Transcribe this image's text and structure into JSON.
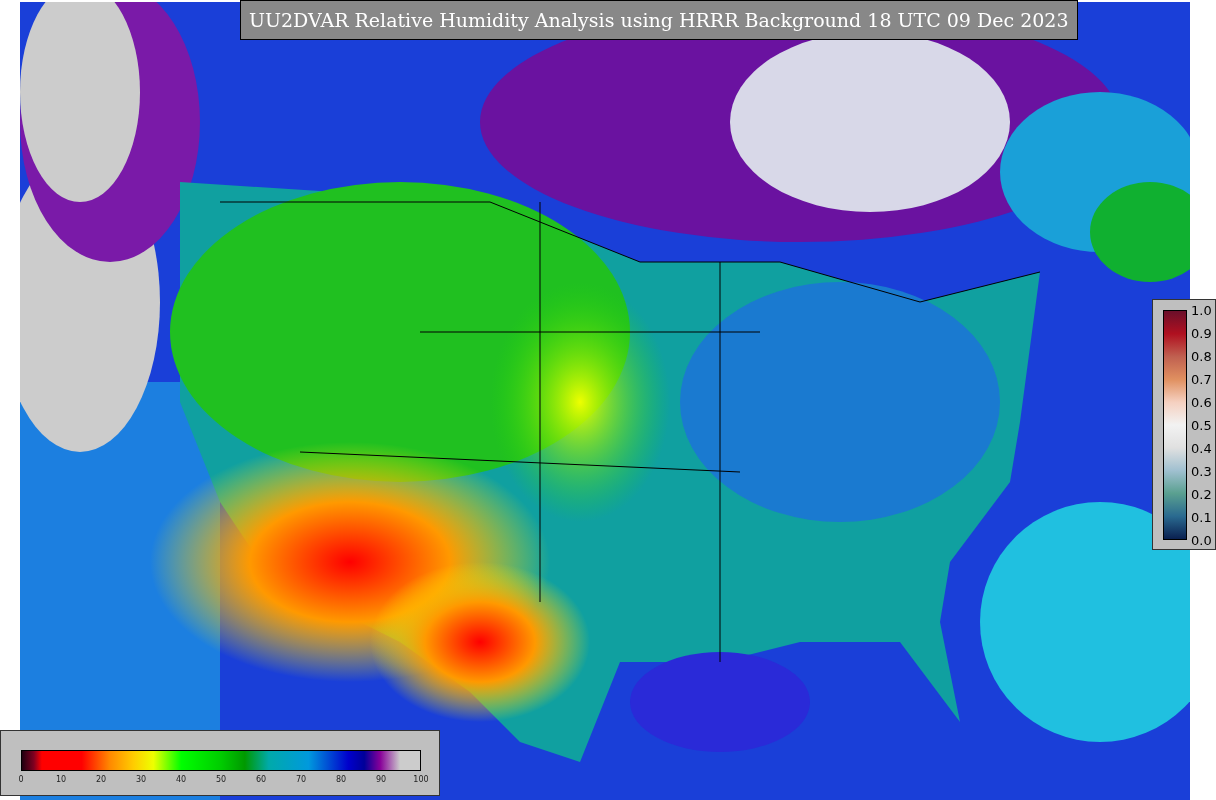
{
  "title": "UU2DVAR Relative Humidity Analysis using HRRR Background 18 UTC 09 Dec 2023",
  "humidity_legend": {
    "ticks": [
      "0",
      "10",
      "20",
      "30",
      "40",
      "50",
      "60",
      "70",
      "80",
      "90",
      "100"
    ]
  },
  "observation_legend": {
    "ticks": [
      "1.0",
      "0.9",
      "0.8",
      "0.7",
      "0.6",
      "0.5",
      "0.4",
      "0.3",
      "0.2",
      "0.1",
      "0.0"
    ]
  }
}
